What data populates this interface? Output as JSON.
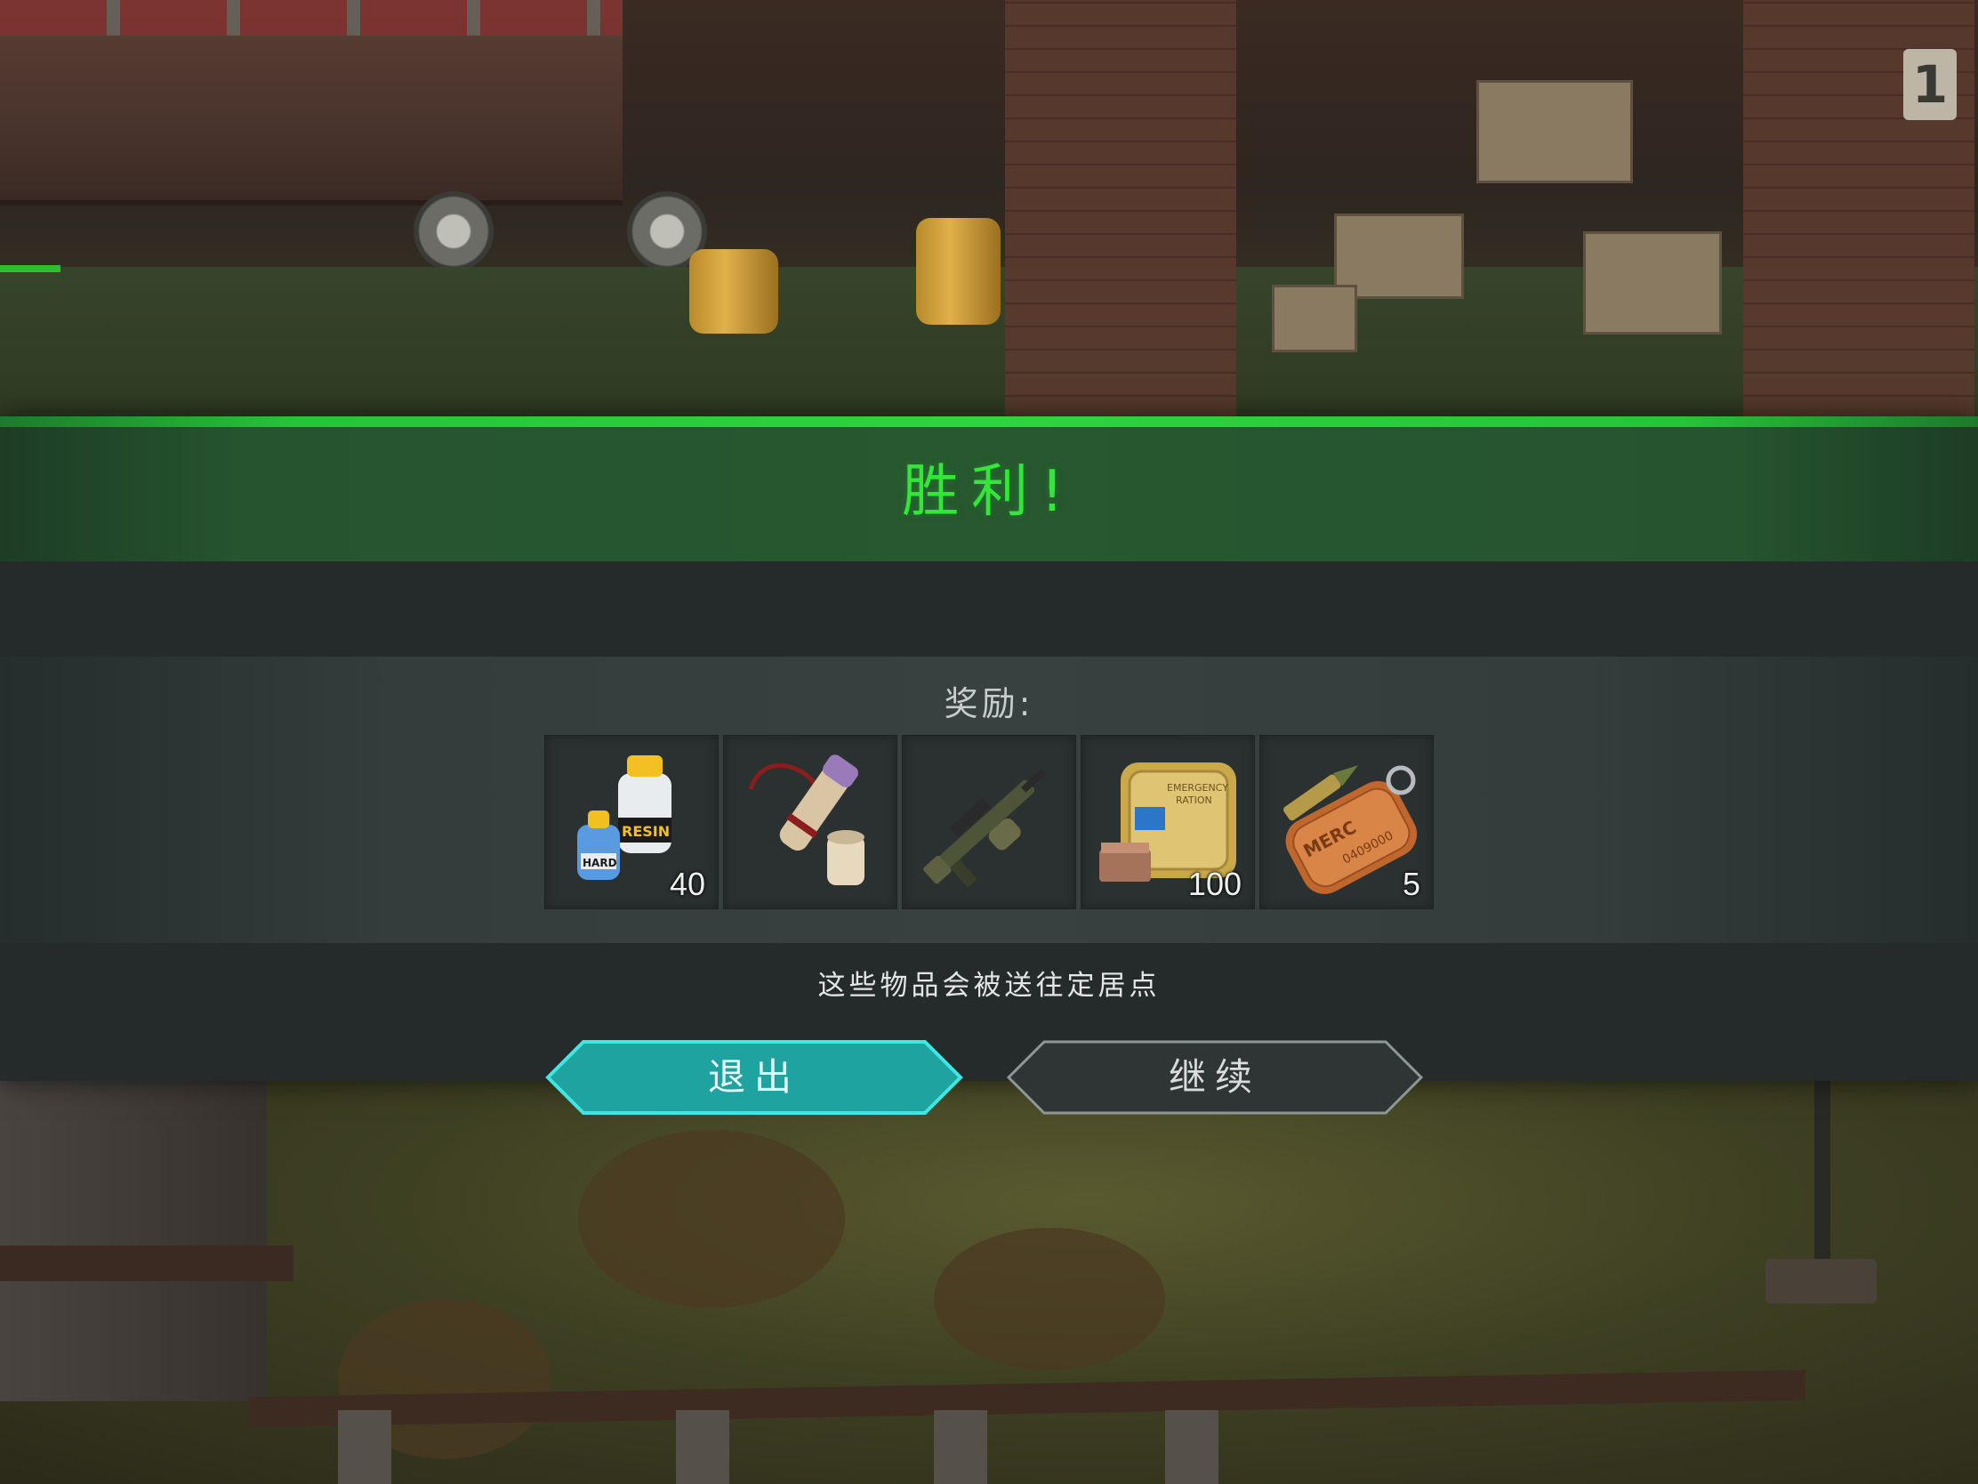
{
  "hud": {
    "progress_badge": "1"
  },
  "victory": {
    "title": "胜利!",
    "rewards_label": "奖励:",
    "info_text": "这些物品会被送往定居点",
    "accent_color": "#35e63a"
  },
  "rewards": [
    {
      "icon": "resin-hardener-icon",
      "quantity": "40"
    },
    {
      "icon": "blueprint-scroll-icon",
      "quantity": ""
    },
    {
      "icon": "grenade-launcher-rifle-icon",
      "quantity": ""
    },
    {
      "icon": "emergency-ration-icon",
      "quantity": "100"
    },
    {
      "icon": "merc-dog-tag-icon",
      "quantity": "5"
    }
  ],
  "buttons": {
    "exit_label": "退出",
    "continue_label": "继续",
    "exit_color": "#1fa3a0",
    "continue_color": "#2f3535"
  }
}
